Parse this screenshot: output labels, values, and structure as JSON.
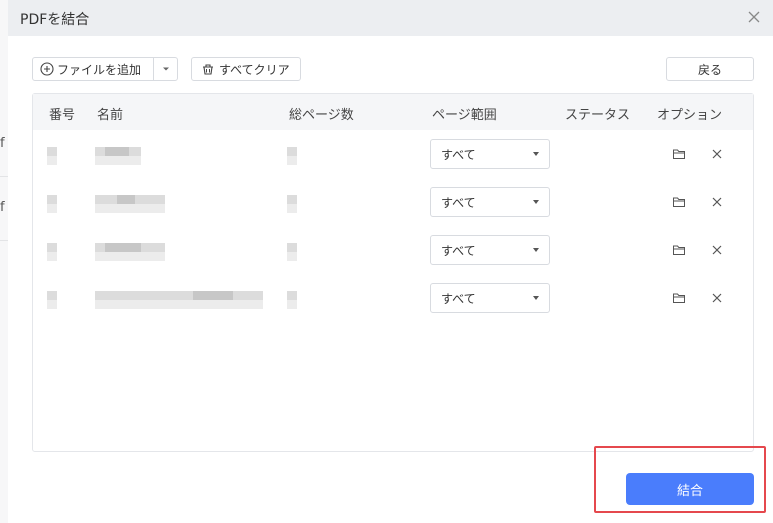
{
  "background_app": {
    "fragment_1": "f",
    "fragment_2": "f"
  },
  "dialog": {
    "title": "PDFを結合",
    "toolbar": {
      "add_files_label": "ファイルを追加",
      "clear_all_label": "すべてクリア",
      "back_label": "戻る"
    },
    "table": {
      "columns": [
        "番号",
        "名前",
        "総ページ数",
        "ページ範囲",
        "ステータス",
        "オプション"
      ],
      "rows": [
        {
          "page_range": "すべて"
        },
        {
          "page_range": "すべて"
        },
        {
          "page_range": "すべて"
        },
        {
          "page_range": "すべて"
        }
      ]
    },
    "merge_label": "結合"
  },
  "colors": {
    "accent": "#4a7dfc",
    "highlight": "#e5484d"
  }
}
